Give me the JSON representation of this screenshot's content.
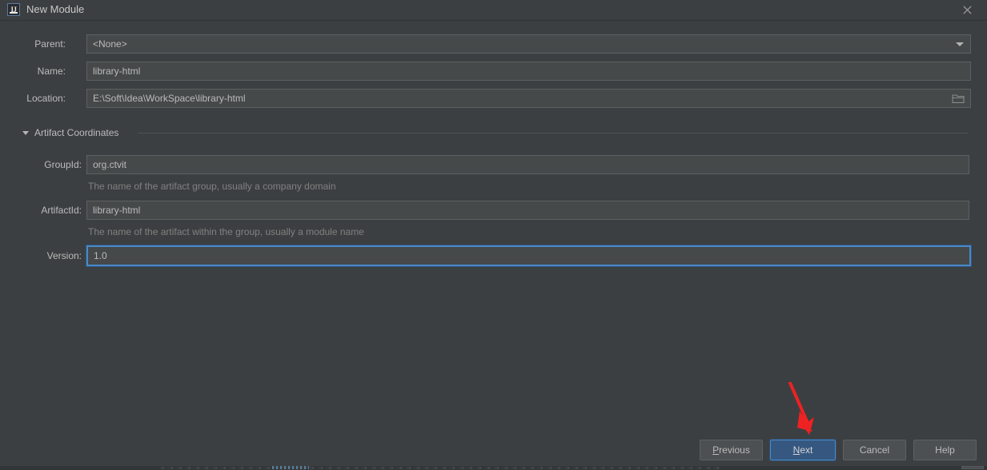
{
  "window": {
    "title": "New Module",
    "app_icon": "intellij-idea-icon",
    "close_icon": "close-icon"
  },
  "form": {
    "parent": {
      "label": "Parent:",
      "value": "<None>",
      "dropdown_icon": "chevron-down-icon"
    },
    "name": {
      "label": "Name:",
      "value": "library-html"
    },
    "location": {
      "label": "Location:",
      "value": "E:\\Soft\\Idea\\WorkSpace\\library-html",
      "browse_icon": "folder-icon"
    }
  },
  "artifact_section": {
    "title": "Artifact Coordinates",
    "expanded": true,
    "toggle_icon": "triangle-down-icon",
    "fields": {
      "group_id": {
        "label": "GroupId:",
        "value": "org.ctvit",
        "hint": "The name of the artifact group, usually a company domain"
      },
      "artifact_id": {
        "label": "ArtifactId:",
        "value": "library-html",
        "hint": "The name of the artifact within the group, usually a module name"
      },
      "version": {
        "label": "Version:",
        "value": "1.0",
        "focused": true
      }
    }
  },
  "buttons": {
    "previous": {
      "label": "Previous",
      "mnemonic": "P",
      "before": "",
      "after": "revious"
    },
    "next": {
      "label": "Next",
      "mnemonic": "N",
      "before": "",
      "after": "ext",
      "primary": true
    },
    "cancel": {
      "label": "Cancel"
    },
    "help": {
      "label": "Help"
    }
  },
  "annotation": {
    "arrow_icon": "red-arrow-down-icon",
    "color": "#ee2222",
    "points_at": "next-button"
  },
  "colors": {
    "dialog_background": "#3c3f41",
    "field_background": "#45494a",
    "field_border": "#5e6060",
    "text": "#bbbbbb",
    "hint_text": "#808080",
    "focus_blue": "#4a88c7",
    "primary_button": "#365880",
    "annotation_red": "#ee2222"
  }
}
